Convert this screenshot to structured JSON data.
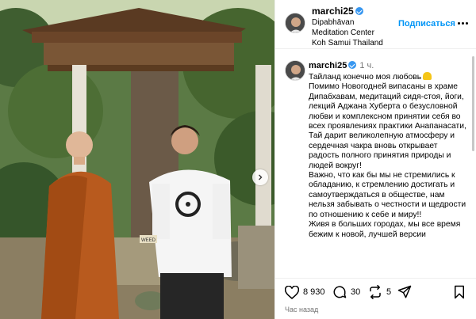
{
  "post": {
    "username": "marchi25",
    "location": "Dipabhāvan Meditation Center Koh Samui Thailand",
    "follow_label": "Подписаться",
    "caption": {
      "username": "marchi25",
      "time": "1 ч.",
      "text": "Тайланд конечно моя любовь\nПомимо Новогодней випасаны в храме Дипабхавам, медитаций сидя-стоя, йоги, лекций Аджана Хуберта о безусловной любви и комплексном принятии себя во всех проявлениях практики Анапанасати, Тай дарит великолепную атмосферу и сердечная чакра вновь открывает радость полного принятия природы и людей вокруг!\nВажно,  что как бы мы не стремились к обладанию, к стремлению достигать и самоутверждаться в обществе, нам нельзя забывать о честности и щедрости по отношению к себе и миру!!\nЖивя в больших городах, мы все время бежим к новой, лучшей версии"
    },
    "sign_text": "WEED",
    "actions": {
      "likes": "8 930",
      "comments": "30",
      "reposts": "5"
    },
    "timestamp": "Час назад"
  },
  "icons": {
    "verified": "verified-badge-icon",
    "more": "more-options-icon",
    "next": "chevron-right-icon",
    "like": "heart-icon",
    "comment": "comment-bubble-icon",
    "repost": "repost-icon",
    "share": "paper-plane-icon",
    "save": "bookmark-icon"
  },
  "colors": {
    "accent": "#0095f6",
    "verified": "#3897f0",
    "robe": "#b85a1e",
    "secondary_text": "#737373"
  }
}
